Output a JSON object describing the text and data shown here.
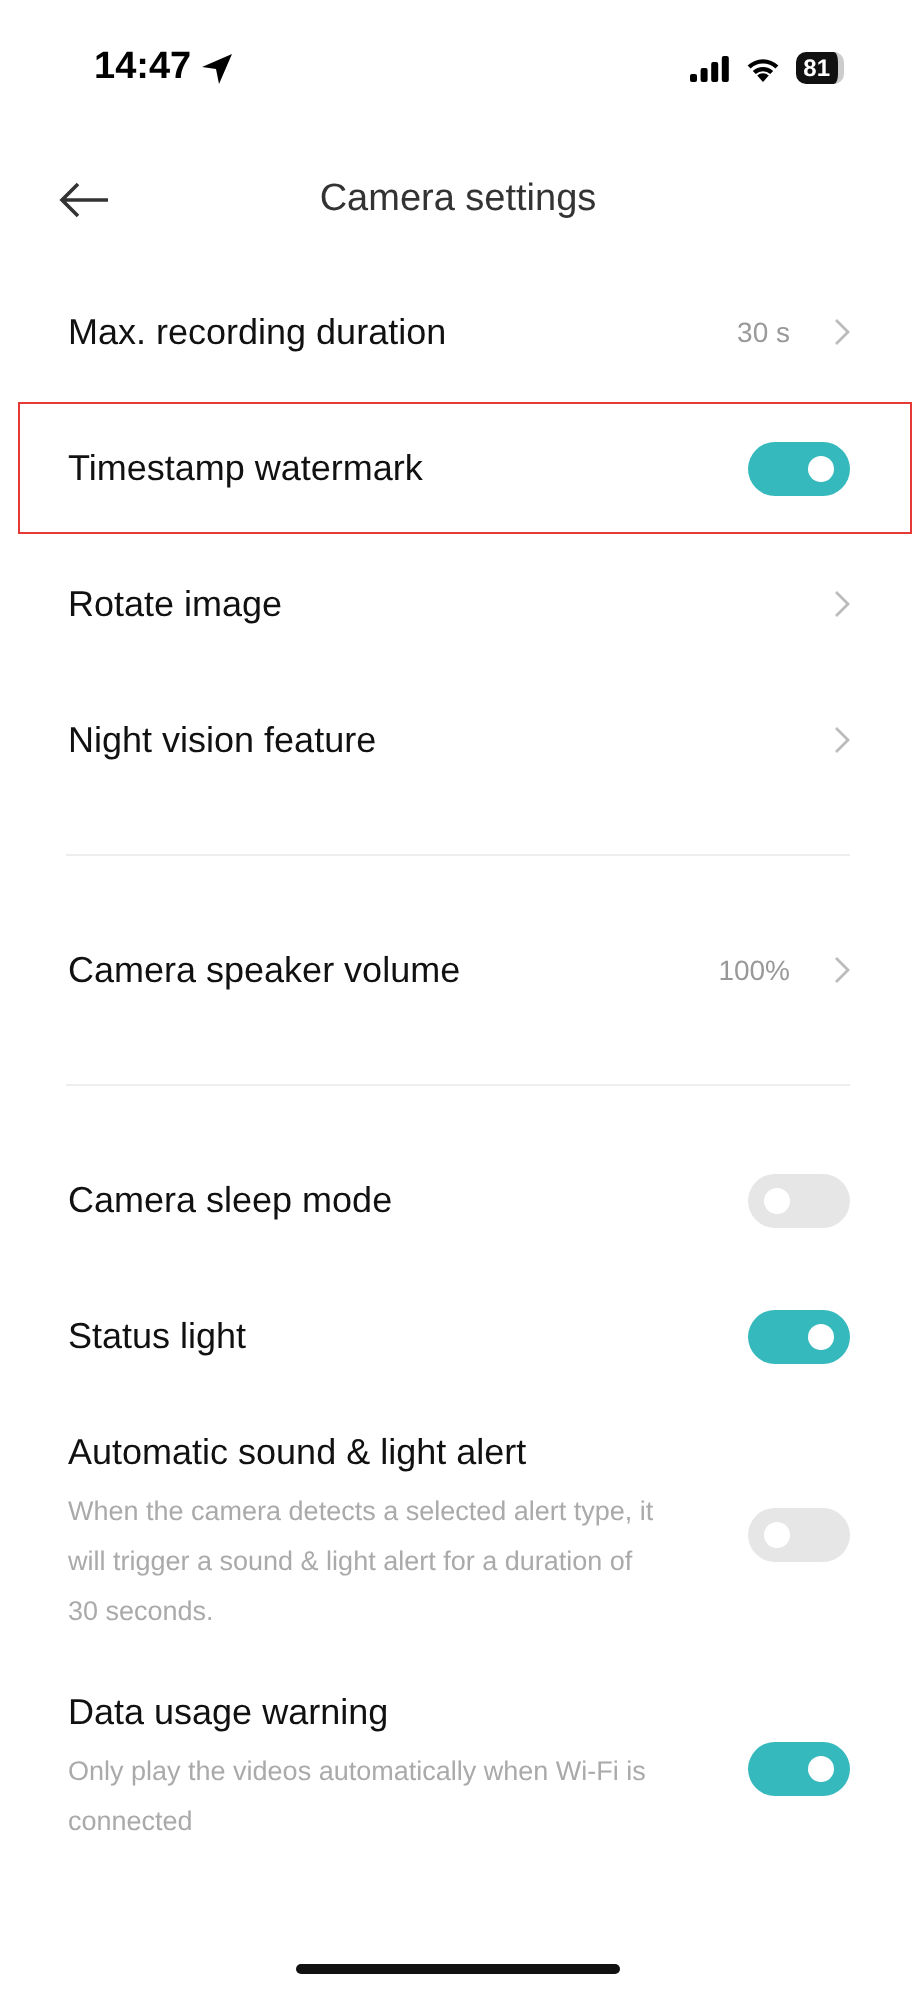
{
  "status_bar": {
    "time": "14:47",
    "battery": "81"
  },
  "header": {
    "title": "Camera settings"
  },
  "sections": [
    {
      "items": [
        {
          "kind": "link",
          "label": "Max. recording duration",
          "value": "30 s"
        },
        {
          "kind": "toggle",
          "label": "Timestamp watermark",
          "on": true,
          "highlighted": true
        },
        {
          "kind": "link",
          "label": "Rotate image"
        },
        {
          "kind": "link",
          "label": "Night vision feature"
        }
      ]
    },
    {
      "items": [
        {
          "kind": "link",
          "label": "Camera speaker volume",
          "value": "100%"
        }
      ]
    },
    {
      "items": [
        {
          "kind": "toggle",
          "label": "Camera sleep mode",
          "on": false
        },
        {
          "kind": "toggle",
          "label": "Status light",
          "on": true
        },
        {
          "kind": "toggle",
          "label": "Automatic sound & light alert",
          "on": false,
          "description": "When the camera detects a selected alert type, it will trigger a sound & light alert for a duration of 30 seconds."
        },
        {
          "kind": "toggle",
          "label": "Data usage warning",
          "on": true,
          "description": "Only play the videos automatically when Wi-Fi is connected"
        }
      ]
    }
  ]
}
